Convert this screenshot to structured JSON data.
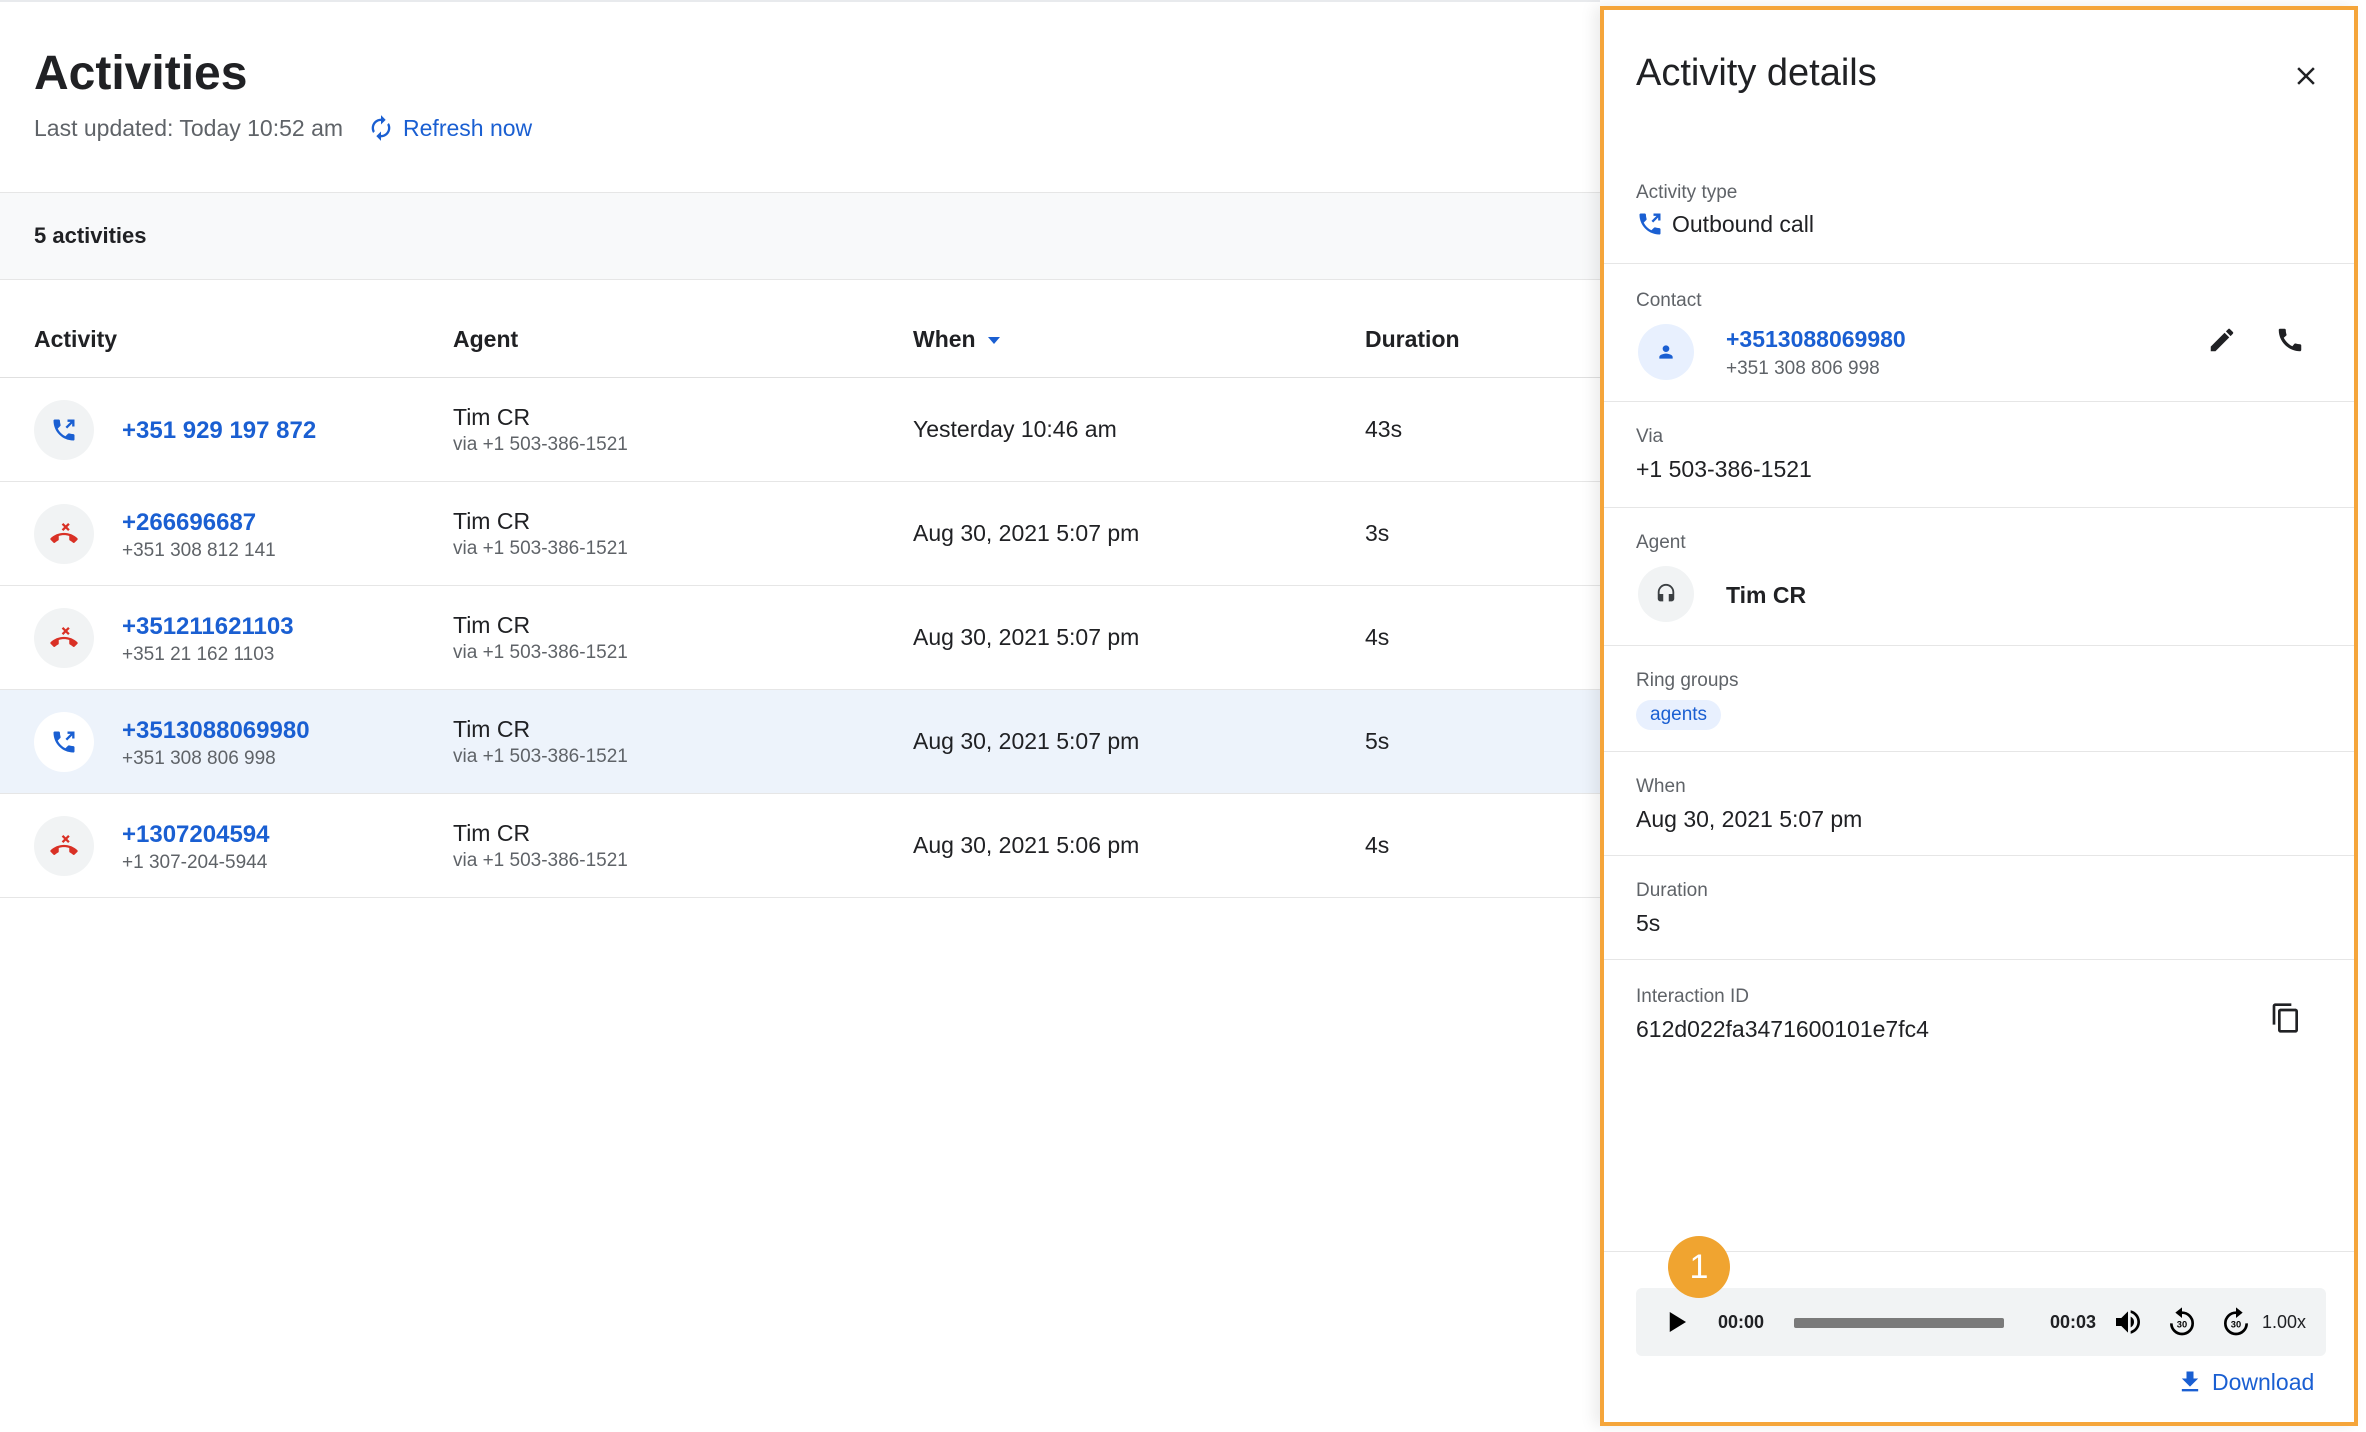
{
  "header": {
    "title": "Activities",
    "last_updated": "Last updated: Today 10:52 am",
    "refresh_label": "Refresh now"
  },
  "count_label": "5 activities",
  "table": {
    "columns": [
      "Activity",
      "Agent",
      "When",
      "Duration"
    ],
    "rows": [
      {
        "type": "outbound",
        "primary": "+351 929 197 872",
        "secondary": "",
        "agent": "Tim CR",
        "via": "via +1 503-386-1521",
        "when": "Yesterday 10:46 am",
        "duration": "43s"
      },
      {
        "type": "missed",
        "primary": "+266696687",
        "secondary": "+351 308 812 141",
        "agent": "Tim CR",
        "via": "via +1 503-386-1521",
        "when": "Aug 30, 2021 5:07 pm",
        "duration": "3s"
      },
      {
        "type": "missed",
        "primary": "+351211621103",
        "secondary": "+351 21 162 1103",
        "agent": "Tim CR",
        "via": "via +1 503-386-1521",
        "when": "Aug 30, 2021 5:07 pm",
        "duration": "4s"
      },
      {
        "type": "outbound",
        "primary": "+3513088069980",
        "secondary": "+351 308 806 998",
        "agent": "Tim CR",
        "via": "via +1 503-386-1521",
        "when": "Aug 30, 2021 5:07 pm",
        "duration": "5s"
      },
      {
        "type": "missed",
        "primary": "+1307204594",
        "secondary": "+1 307-204-5944",
        "agent": "Tim CR",
        "via": "via +1 503-386-1521",
        "when": "Aug 30, 2021 5:06 pm",
        "duration": "4s"
      }
    ],
    "selected_row_index": 3
  },
  "details": {
    "title": "Activity details",
    "activity_type": {
      "label": "Activity type",
      "value": "Outbound call"
    },
    "contact": {
      "label": "Contact",
      "number": "+3513088069980",
      "formatted": "+351 308 806 998"
    },
    "via": {
      "label": "Via",
      "value": "+1 503-386-1521"
    },
    "agent": {
      "label": "Agent",
      "name": "Tim CR"
    },
    "ring_groups": {
      "label": "Ring groups",
      "chips": [
        "agents"
      ]
    },
    "when": {
      "label": "When",
      "value": "Aug 30, 2021 5:07 pm"
    },
    "duration": {
      "label": "Duration",
      "value": "5s"
    },
    "interaction_id": {
      "label": "Interaction ID",
      "value": "612d022fa3471600101e7fc4"
    },
    "player": {
      "current_time": "00:00",
      "total_time": "00:03",
      "progress": 0,
      "speed": "1.00x"
    },
    "badge": "1",
    "download_label": "Download"
  },
  "colors": {
    "link": "#1a5fd2",
    "missed_call": "#d93025",
    "panel_highlight": "#f5a53a",
    "badge": "#f0a430",
    "selected_row": "#edf3fb"
  },
  "icons": {
    "outbound": "outbound-call-icon",
    "missed": "missed-call-icon",
    "refresh": "refresh-icon",
    "close": "close-icon",
    "edit": "pencil-icon",
    "call": "phone-icon",
    "person": "person-icon",
    "headset": "headset-icon",
    "copy": "copy-icon",
    "play": "play-icon",
    "volume": "volume-icon",
    "rewind": "rewind-30-icon",
    "forward": "forward-30-icon",
    "download": "download-icon"
  }
}
